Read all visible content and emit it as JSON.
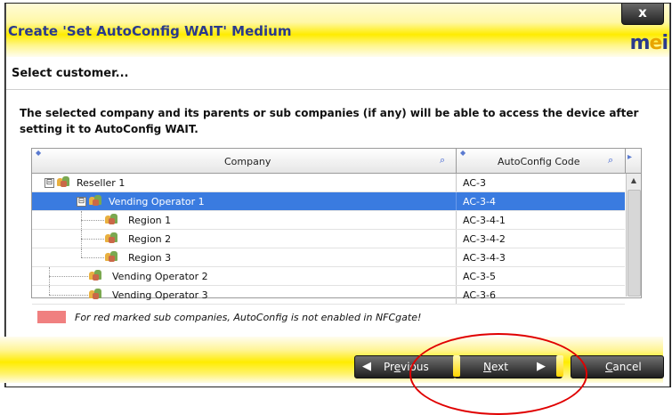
{
  "window": {
    "title": "Create 'Set AutoConfig WAIT' Medium",
    "close_label": "x",
    "logo_m": "m",
    "logo_e": "e",
    "logo_i": "i"
  },
  "step": {
    "title": "Select customer..."
  },
  "description": "The selected company and its parents or sub companies (if any) will be able to access the device after setting it to AutoConfig WAIT.",
  "grid": {
    "columns": {
      "company": "Company",
      "code": "AutoConfig Code"
    },
    "rows": [
      {
        "name": "Reseller 1",
        "code": "AC-3",
        "toggle": "⊟"
      },
      {
        "name": "Vending Operator 1",
        "code": "AC-3-4",
        "toggle": "⊟"
      },
      {
        "name": "Region 1",
        "code": "AC-3-4-1"
      },
      {
        "name": "Region 2",
        "code": "AC-3-4-2"
      },
      {
        "name": "Region 3",
        "code": "AC-3-4-3"
      },
      {
        "name": "Vending Operator 2",
        "code": "AC-3-5"
      },
      {
        "name": "Vending Operator 3",
        "code": "AC-3-6"
      }
    ],
    "selected_row": "Vending Operator 1"
  },
  "legend": {
    "text": "For red marked sub companies, AutoConfig is not enabled in NFCgate!",
    "color": "#f08080"
  },
  "buttons": {
    "previous": {
      "pre": "Pr",
      "u": "e",
      "post": "vious"
    },
    "next": {
      "pre": "",
      "u": "N",
      "post": "ext"
    },
    "cancel": {
      "pre": "",
      "u": "C",
      "post": "ancel"
    }
  },
  "colors": {
    "title_text": "#2a3a8c",
    "selection": "#3a7be0",
    "annotation": "#e00000"
  }
}
